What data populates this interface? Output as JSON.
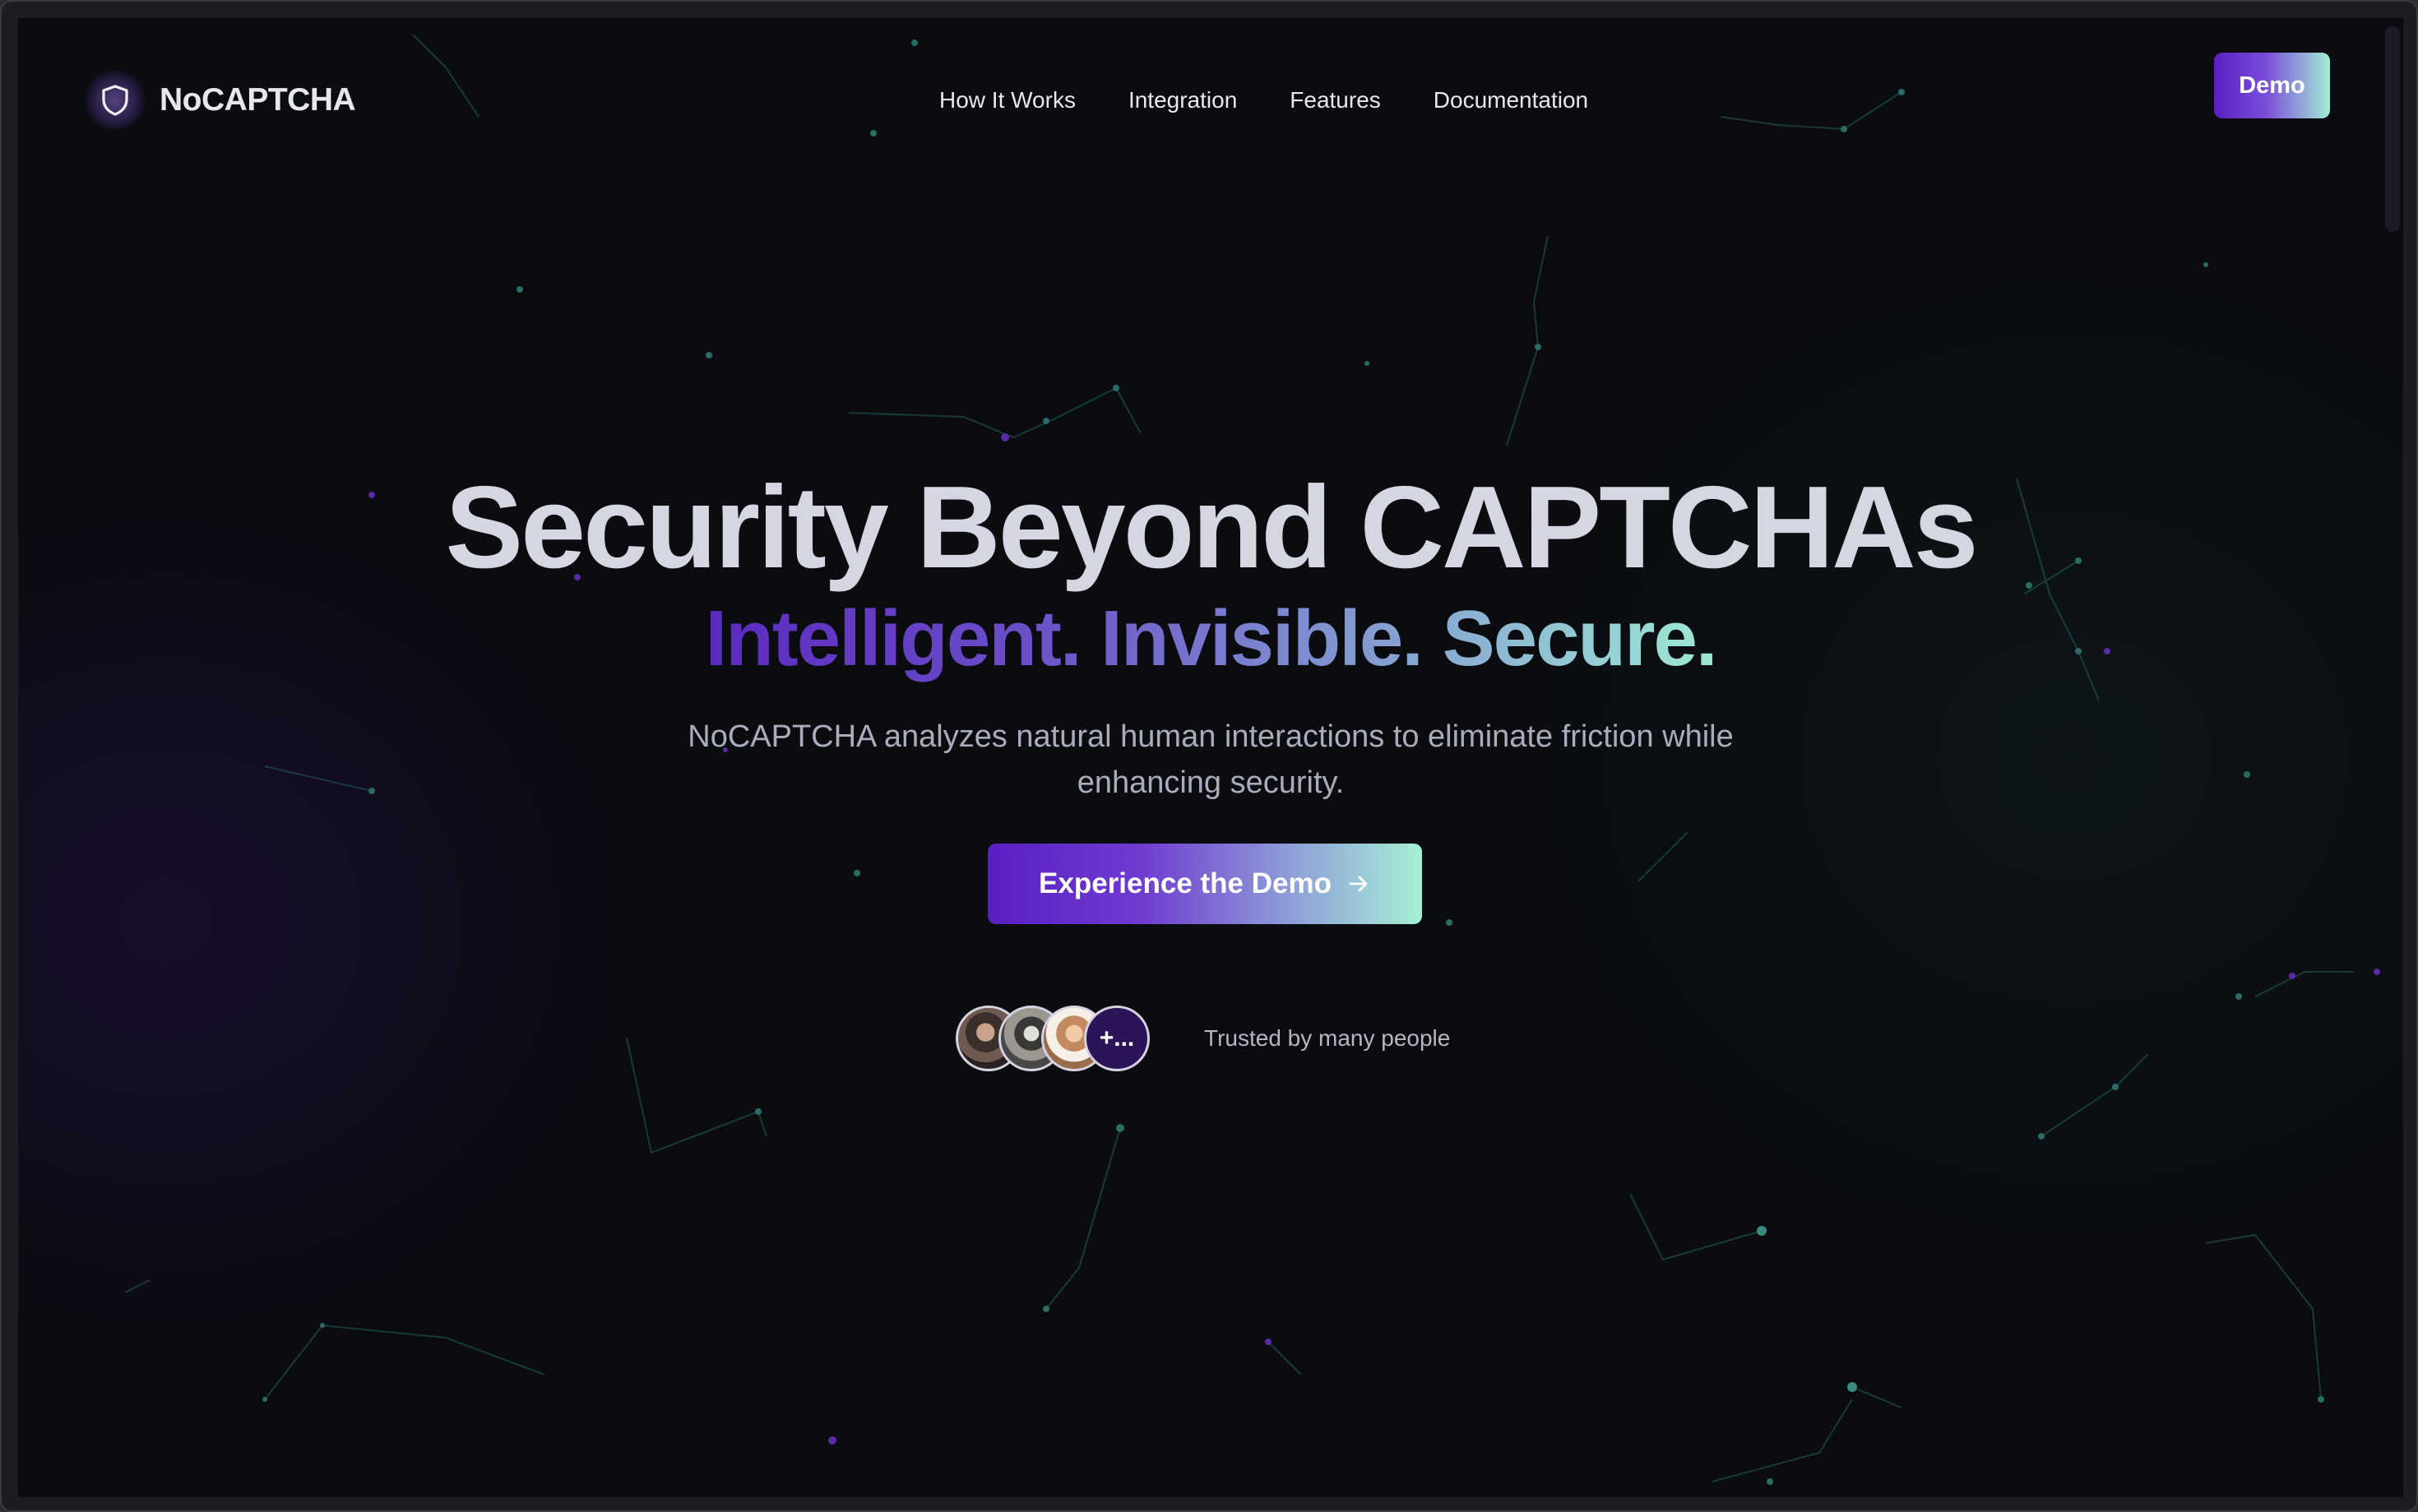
{
  "brand": {
    "name": "NoCAPTCHA",
    "icon": "shield-icon"
  },
  "nav": {
    "items": [
      {
        "label": "How It Works"
      },
      {
        "label": "Integration"
      },
      {
        "label": "Features"
      },
      {
        "label": "Documentation"
      }
    ],
    "demo_label": "Demo"
  },
  "hero": {
    "title": "Security Beyond CAPTCHAs",
    "subtitle": "Intelligent. Invisible. Secure.",
    "description": "NoCAPTCHA analyzes natural human interactions to eliminate friction while enhancing security.",
    "cta_label": "Experience the Demo",
    "cta_icon": "arrow-right-icon"
  },
  "trust": {
    "more_label": "+...",
    "text": "Trusted by many people"
  },
  "colors": {
    "background": "#0a0c10",
    "accent_purple": "#5a1fc4",
    "accent_mint": "#a6f0d6",
    "title": "#d4d7e2"
  }
}
